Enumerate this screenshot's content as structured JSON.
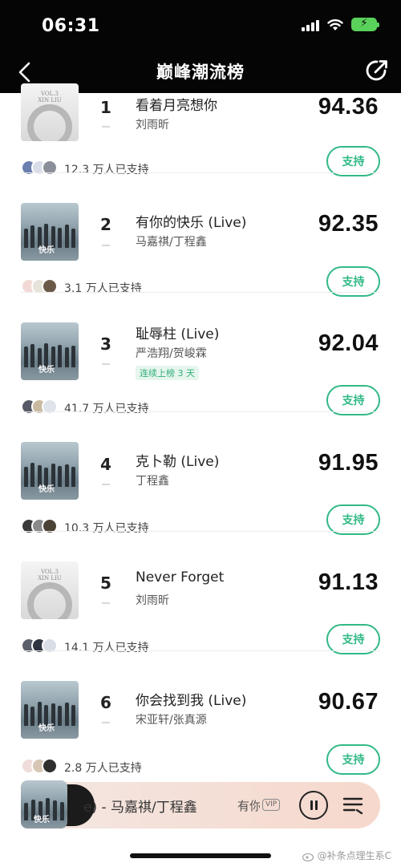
{
  "status_bar": {
    "time": "06:31"
  },
  "header": {
    "title": "巅峰潮流榜",
    "back_icon": "chevron-left-icon",
    "share_icon": "share-icon"
  },
  "entries": [
    {
      "rank": "1",
      "title": "看着月亮想你",
      "artist": "刘雨昕",
      "score": "94.36",
      "supporters": "12.3 万人已支持",
      "button": "支持",
      "cover": "gray"
    },
    {
      "rank": "2",
      "title": "有你的快乐 (Live)",
      "artist": "马嘉祺/丁程鑫",
      "score": "92.35",
      "supporters": "3.1 万人已支持",
      "button": "支持",
      "cover": "photo"
    },
    {
      "rank": "3",
      "title": "耻辱柱 (Live)",
      "artist": "严浩翔/贺峻霖",
      "score": "92.04",
      "streak": "连续上榜 3 天",
      "supporters": "41.7 万人已支持",
      "button": "支持",
      "cover": "photo"
    },
    {
      "rank": "4",
      "title": "克卜勒 (Live)",
      "artist": "丁程鑫",
      "score": "91.95",
      "supporters": "10.3 万人已支持",
      "button": "支持",
      "cover": "photo"
    },
    {
      "rank": "5",
      "title": "Never Forget",
      "artist": "刘雨昕",
      "score": "91.13",
      "supporters": "14.1 万人已支持",
      "button": "支持",
      "cover": "gray"
    },
    {
      "rank": "6",
      "title": "你会找到我 (Live)",
      "artist": "宋亚轩/张真源",
      "score": "90.67",
      "supporters": "2.8 万人已支持",
      "button": "支持",
      "cover": "photo"
    }
  ],
  "player": {
    "now_playing": "e) - 马嘉祺/丁程鑫",
    "next": "有你",
    "vip": "VIP"
  },
  "watermark": "@补条点理生系C",
  "colors": {
    "accent": "#32b986",
    "header_bg": "#050505"
  }
}
